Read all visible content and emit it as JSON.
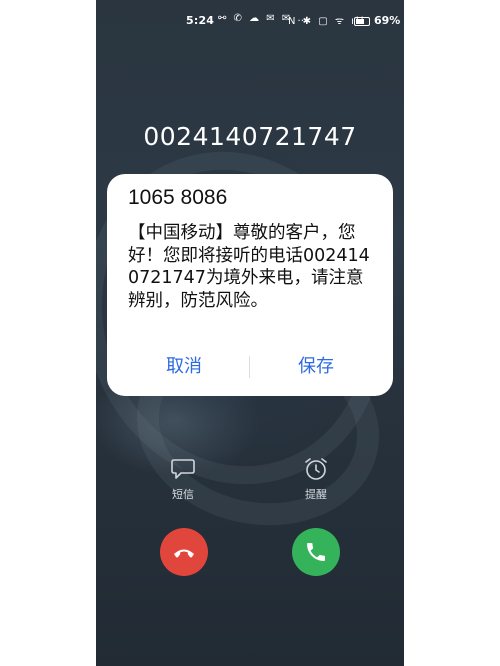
{
  "status_bar": {
    "time": "5:24",
    "left_icons": "⚯ ✆ ☁ ✉ ✉ …",
    "right_icons": "N ✱ ▢ ᯤ ıll",
    "battery_level": 0.69,
    "battery": "69%"
  },
  "call": {
    "number": "0024140721747"
  },
  "sms_dialog": {
    "sender": "1065 8086",
    "message": "【中国移动】尊敬的客户，您好！您即将接听的电话0024140721747为境外来电，请注意辨别，防范风险。",
    "cancel_label": "取消",
    "save_label": "保存"
  },
  "quick_actions": {
    "message_label": "短信",
    "remind_label": "提醒"
  },
  "colors": {
    "accent": "#2d6ae3",
    "decline": "#e0463c",
    "answer": "#35b35a"
  },
  "icons": {
    "message": "message-bubble-icon",
    "remind": "alarm-clock-icon",
    "decline": "hang-up-icon",
    "answer": "phone-answer-icon"
  }
}
